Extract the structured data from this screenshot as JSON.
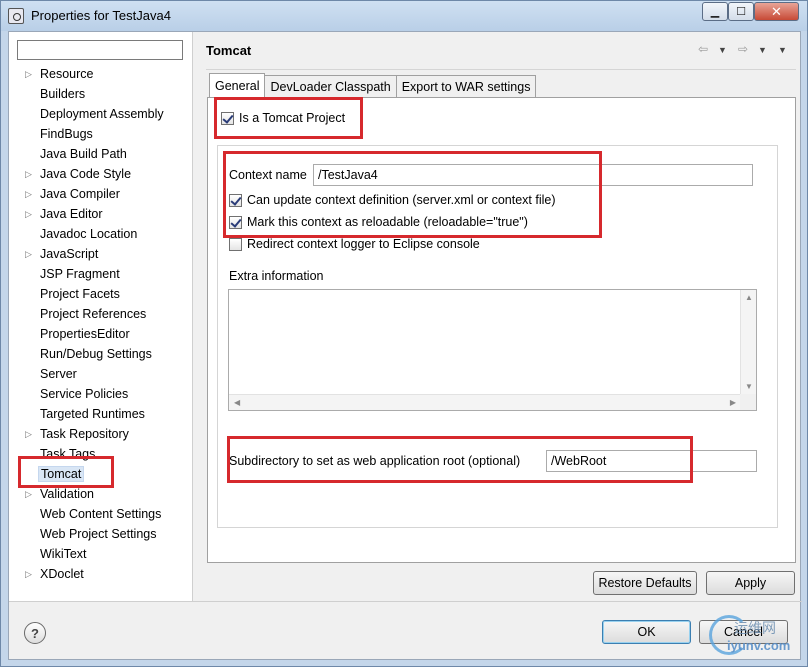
{
  "window": {
    "title": "Properties for TestJava4"
  },
  "nav": {
    "filter_value": "",
    "items": [
      {
        "label": "Resource",
        "expandable": true
      },
      {
        "label": "Builders",
        "expandable": false
      },
      {
        "label": "Deployment Assembly",
        "expandable": false
      },
      {
        "label": "FindBugs",
        "expandable": false
      },
      {
        "label": "Java Build Path",
        "expandable": false
      },
      {
        "label": "Java Code Style",
        "expandable": true
      },
      {
        "label": "Java Compiler",
        "expandable": true
      },
      {
        "label": "Java Editor",
        "expandable": true
      },
      {
        "label": "Javadoc Location",
        "expandable": false
      },
      {
        "label": "JavaScript",
        "expandable": true
      },
      {
        "label": "JSP Fragment",
        "expandable": false
      },
      {
        "label": "Project Facets",
        "expandable": false
      },
      {
        "label": "Project References",
        "expandable": false
      },
      {
        "label": "PropertiesEditor",
        "expandable": false
      },
      {
        "label": "Run/Debug Settings",
        "expandable": false
      },
      {
        "label": "Server",
        "expandable": false
      },
      {
        "label": "Service Policies",
        "expandable": false
      },
      {
        "label": "Targeted Runtimes",
        "expandable": false
      },
      {
        "label": "Task Repository",
        "expandable": true
      },
      {
        "label": "Task Tags",
        "expandable": false
      },
      {
        "label": "Tomcat",
        "expandable": false,
        "selected": true
      },
      {
        "label": "Validation",
        "expandable": true
      },
      {
        "label": "Web Content Settings",
        "expandable": false
      },
      {
        "label": "Web Project Settings",
        "expandable": false
      },
      {
        "label": "WikiText",
        "expandable": false
      },
      {
        "label": "XDoclet",
        "expandable": true
      }
    ]
  },
  "panel": {
    "title": "Tomcat",
    "history_icons": [
      "back-arrow-icon",
      "forward-arrow-icon",
      "view-menu-icon"
    ]
  },
  "tabs": [
    {
      "label": "General",
      "active": true
    },
    {
      "label": "DevLoader Classpath",
      "active": false
    },
    {
      "label": "Export to WAR settings",
      "active": false
    }
  ],
  "general": {
    "is_tomcat_project": {
      "label": "Is a Tomcat Project",
      "checked": true
    },
    "context_name": {
      "label": "Context name",
      "value": "/TestJava4"
    },
    "can_update_context": {
      "label": "Can update context definition (server.xml or context file)",
      "checked": true
    },
    "mark_reloadable": {
      "label": "Mark this context as reloadable (reloadable=\"true\")",
      "checked": true
    },
    "redirect_logger": {
      "label": "Redirect context logger to Eclipse console",
      "checked": false
    },
    "extra_info": {
      "label": "Extra information",
      "value": ""
    },
    "webapp_root": {
      "label": "Subdirectory to set as web application root (optional)",
      "value": "/WebRoot"
    }
  },
  "buttons": {
    "restore_defaults": "Restore Defaults",
    "apply": "Apply",
    "ok": "OK",
    "cancel": "Cancel"
  },
  "watermark": {
    "text_cn": "运维网",
    "url": "iyunv.com"
  },
  "colors": {
    "highlight": "#d6292d",
    "selection": "#d9e6f5"
  }
}
